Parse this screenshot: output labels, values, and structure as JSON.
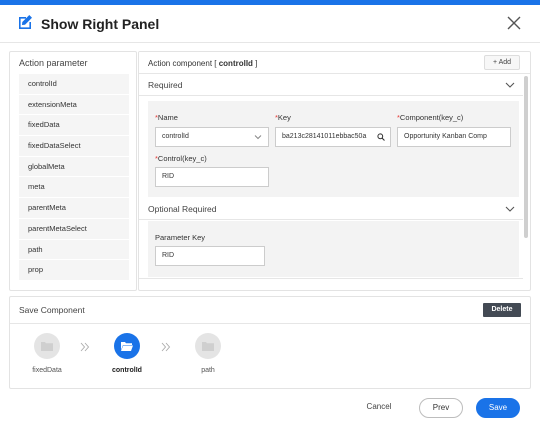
{
  "dialog": {
    "title": "Show Right Panel"
  },
  "left_panel": {
    "title": "Action parameter",
    "items": [
      "controlId",
      "extensionMeta",
      "fixedData",
      "fixedDataSelect",
      "globalMeta",
      "meta",
      "parentMeta",
      "parentMetaSelect",
      "path",
      "prop"
    ]
  },
  "right_panel": {
    "title_prefix": "Action component [",
    "title_value": "controlId",
    "title_suffix": "]",
    "add_label": "+ Add",
    "required": {
      "label": "Required",
      "name_label": "Name",
      "name_value": "controlId",
      "key_label": "Key",
      "key_value": "ba213c28141011ebbac50a",
      "component_label": "Component(key_c)",
      "component_value": "Opportunity Kanban Comp",
      "control_label": "Control(key_c)",
      "control_value": "RID"
    },
    "optional": {
      "label": "Optional Required",
      "param_key_label": "Parameter Key",
      "param_key_value": "RID"
    }
  },
  "save_component": {
    "title": "Save Component",
    "delete_label": "Delete",
    "steps": [
      {
        "label": "fixedData"
      },
      {
        "label": "controlId"
      },
      {
        "label": "path"
      }
    ]
  },
  "footer": {
    "cancel_label": "Cancel",
    "prev_label": "Prev",
    "save_label": "Save"
  },
  "colors": {
    "accent": "#1a73e8",
    "required_star": "#e53935",
    "delete_bg": "#434a54"
  }
}
